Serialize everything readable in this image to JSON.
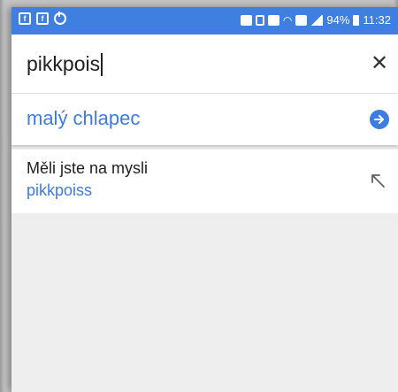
{
  "colors": {
    "status_bar": "#3f7fe0",
    "accent": "#3d7de0",
    "text": "#212121",
    "background": "#eeeeee"
  },
  "status_bar": {
    "left_icons": [
      "app-icon",
      "app-icon",
      "sync-icon"
    ],
    "right_icons": [
      "lock-icon",
      "mute-icon",
      "alarm-icon",
      "wifi-icon",
      "sim-icon",
      "signal-icon"
    ],
    "battery": "94%",
    "time": "11:32"
  },
  "search": {
    "query": "pikkpois",
    "clear_icon": "close-icon"
  },
  "suggestion": {
    "text": "malý chlapec",
    "icon": "arrow-right-circle-icon"
  },
  "did_you_mean": {
    "label": "Měli jste na mysli",
    "value": "pikkpoiss",
    "icon": "arrow-up-left-icon"
  }
}
